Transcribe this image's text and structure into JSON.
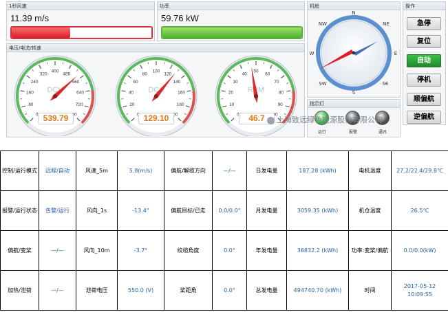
{
  "wind": {
    "title": "1秒风速",
    "value": "11.39 m/s",
    "fraction": 0.42
  },
  "power": {
    "title": "功率",
    "value": "59.76 kW",
    "fraction": 1.0
  },
  "gauges_panel": {
    "title": "电压/电流/转速"
  },
  "gauges": [
    {
      "label": "DCV",
      "value": "539.79",
      "ticks": [
        "0",
        "80",
        "160",
        "240",
        "320",
        "400",
        "480",
        "560",
        "640",
        "720",
        "800"
      ]
    },
    {
      "label": "DCA",
      "value": "129.10",
      "ticks": [
        "0",
        "20",
        "40",
        "60",
        "80",
        "100",
        "120",
        "140",
        "160",
        "180",
        "200"
      ]
    },
    {
      "label": "RPM",
      "value": "46.7",
      "ticks": [
        "0",
        "10",
        "20",
        "30",
        "40",
        "50",
        "60",
        "70",
        "80",
        "90",
        "100"
      ]
    }
  ],
  "compass": {
    "title": "机舱",
    "N": "N",
    "NE": "NE",
    "E": "E",
    "SE": "SE",
    "S": "S",
    "SW": "SW",
    "W": "W",
    "NW": "NW"
  },
  "lamps": {
    "title": "指示灯",
    "items": [
      {
        "label": "运行",
        "color": "#2db53a"
      },
      {
        "label": "报警",
        "color": "#4a4a4a"
      },
      {
        "label": "通讯",
        "color": "#4a4a4a"
      }
    ]
  },
  "ops": {
    "title": "操作",
    "buttons": [
      "急停",
      "复位",
      "自动",
      "停机",
      "顺偏航",
      "逆偏航"
    ],
    "active_index": 2
  },
  "watermark": "上海致远绿色能源股份有限公司",
  "table": [
    [
      "控制/运行模式",
      "远程/自动",
      "风速_5m",
      "5.8(m/s)",
      "偏航/解缆方向",
      "—/—",
      "日发电量",
      "187.28 (kWh)",
      "电机温度",
      "27.2/22.4/29.8℃"
    ],
    [
      "报警/运行状态",
      "告警/运行",
      "风向_1s",
      "-13.4°",
      "偏航目标/已走",
      "0.0/0.0°",
      "月发电量",
      "3059.35 (kWh)",
      "机仓温度",
      "26.5℃"
    ],
    [
      "偏航/变桨",
      "—/—",
      "风向_10m",
      "-3.7°",
      "绞缆角度",
      "0.0°",
      "年发电量",
      "36832.2 (kWh)",
      "功率:变桨/偏航",
      "0.0/0.0(kW)"
    ],
    [
      "加热/泄荷",
      "—/—",
      "泄荷电压",
      "550.0 (V)",
      "桨距角",
      "0.0°",
      "总发电量",
      "494740.70 (kWh)",
      "时间",
      "2017-05-12 10:09:55"
    ]
  ]
}
